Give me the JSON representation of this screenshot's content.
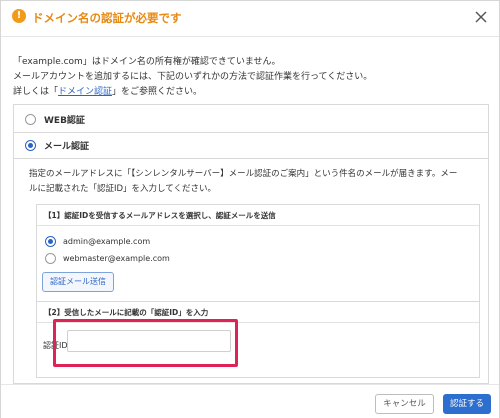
{
  "dialog": {
    "title": "ドメイン名の認証が必要です",
    "accent_color": "#e88a12",
    "icon": "warning-icon",
    "close_icon": "close-icon"
  },
  "intro": {
    "line1": "「example.com」はドメイン名の所有権が確認できていません。",
    "line2": "メールアカウントを追加するには、下記のいずれかの方法で認証作業を行ってください。",
    "line3_prefix": "詳しくは「",
    "line3_link": "ドメイン認証",
    "line3_suffix": "」をご参照ください。"
  },
  "options": {
    "web": {
      "label": "WEB認証",
      "selected": false
    },
    "mail": {
      "label": "メール認証",
      "selected": true
    }
  },
  "mail_auth": {
    "description_line1": "指定のメールアドレスに「【シンレンタルサーバー】メール認証のご案内」という件名のメールが届きます。メー",
    "description_line2": "ルに記載された「認証ID」を入力してください。",
    "step1": {
      "heading": "【1】認証IDを受信するメールアドレスを選択し、認証メールを送信",
      "addresses": [
        {
          "label": "admin@example.com",
          "selected": true
        },
        {
          "label": "webmaster@example.com",
          "selected": false
        }
      ],
      "send_button": "認証メール送信"
    },
    "step2": {
      "heading": "【2】受信したメールに記載の「認証ID」を入力",
      "field_label": "認証ID",
      "field_value": "",
      "highlight_color": "#e02356"
    }
  },
  "footer": {
    "cancel_label": "キャンセル",
    "confirm_label": "認証する",
    "primary_color": "#2d6fcf"
  }
}
